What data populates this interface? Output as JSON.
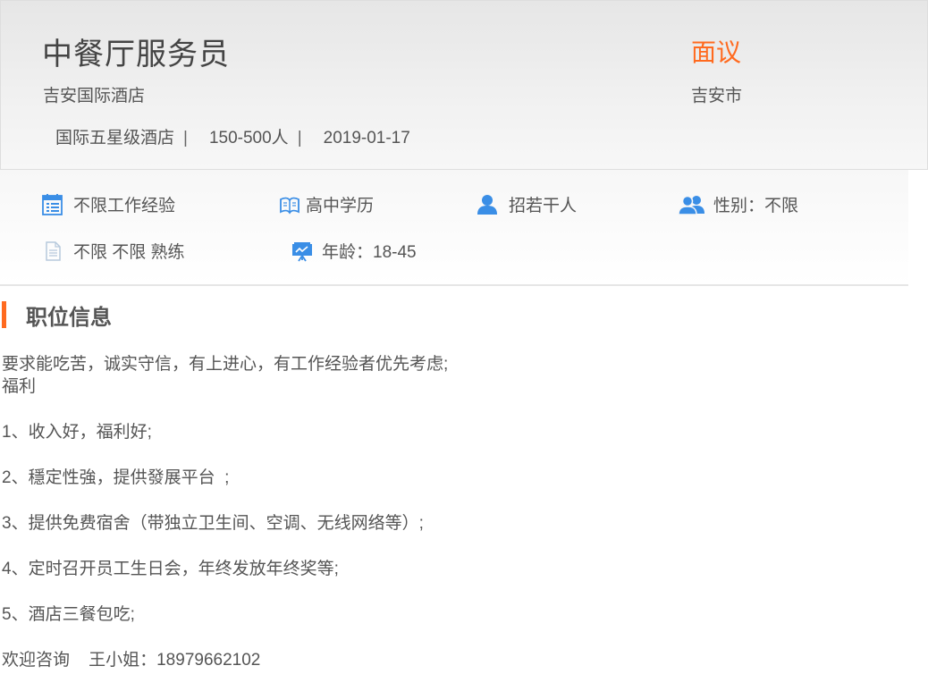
{
  "job": {
    "title": "中餐厅服务员",
    "salary": "面议",
    "company": "吉安国际酒店",
    "city": "吉安市",
    "company_type": "国际五星级酒店",
    "company_size": "150-500人",
    "date": "2019-01-17",
    "separator": "|"
  },
  "features": [
    {
      "icon": "calendar-icon",
      "label": "不限工作经验"
    },
    {
      "icon": "book-icon",
      "label": "高中学历"
    },
    {
      "icon": "person-icon",
      "label": "招若干人"
    },
    {
      "icon": "people-icon",
      "label": "性别：不限"
    },
    {
      "icon": "document-icon",
      "label": "不限 不限 熟练"
    },
    {
      "icon": "presentation-icon",
      "label": "年龄：18-45"
    }
  ],
  "section": {
    "title": "职位信息"
  },
  "description": {
    "line1": "要求能吃苦，诚实守信，有上进心，有工作经验者优先考虑;",
    "line2": "福利",
    "item1": "1、收入好，福利好;",
    "item2": "2、穩定性強，提供發展平台  ;",
    "item3": "3、提供免费宿舍（带独立卫生间、空调、无线网络等）;",
    "item4": "4、定时召开员工生日会，年终发放年终奖等;",
    "item5": "5、酒店三餐包吃;",
    "contact": "欢迎咨询    王小姐：18979662102"
  },
  "colors": {
    "accent": "#ff6a1f",
    "icon_blue": "#3a8ee6",
    "text": "#555555"
  }
}
